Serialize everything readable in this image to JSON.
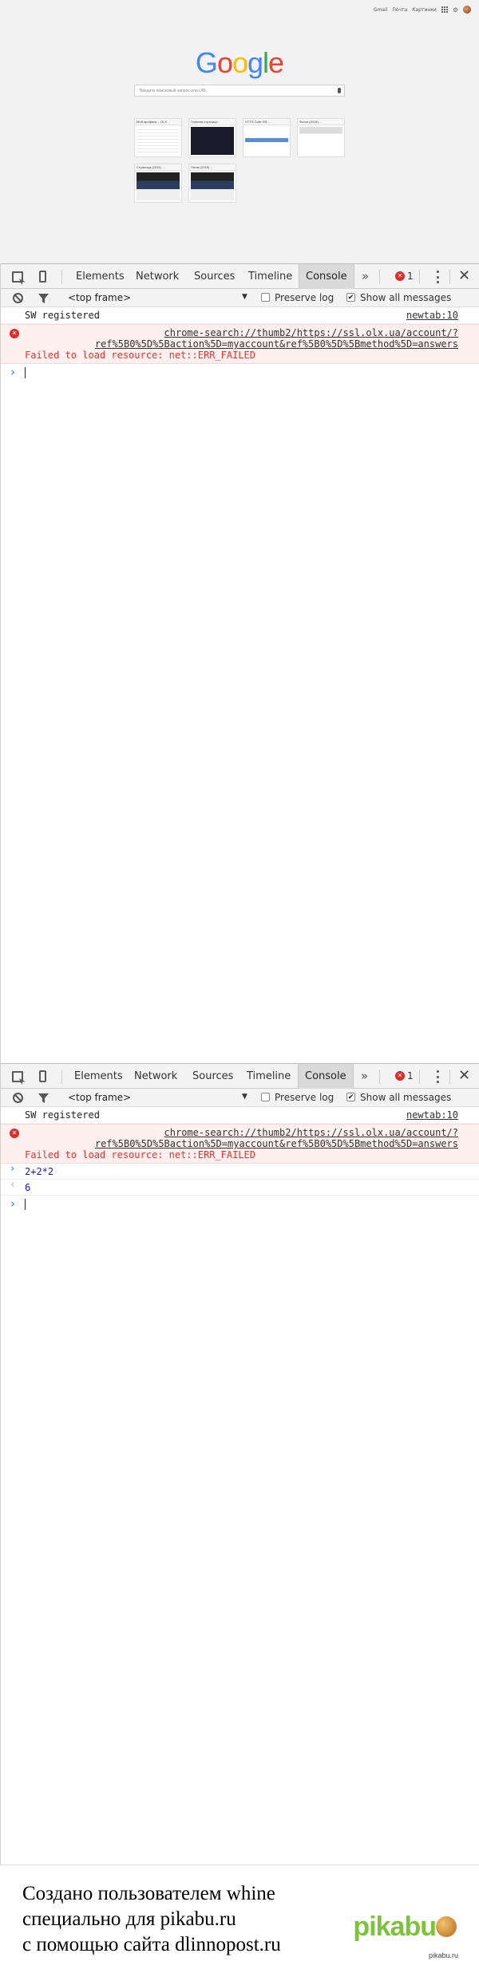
{
  "newtab": {
    "top_links": [
      "Gmail",
      "Почта",
      "Картинки"
    ],
    "search_placeholder": "Введите поисковый запрос или URL",
    "tiles": [
      {
        "title": "Мой профиль – OLX"
      },
      {
        "title": "Главная страница"
      },
      {
        "title": "HTTS Сайт ЛФ…"
      },
      {
        "title": "Фотки (2015) …"
      },
      {
        "title": "Страница (2015) …"
      },
      {
        "title": "Пятак (2015) …"
      }
    ]
  },
  "devtools_top": {
    "tabs": [
      "Elements",
      "Network",
      "Sources",
      "Timeline",
      "Console"
    ],
    "more_label": "»",
    "error_count": "1",
    "filter": {
      "frame": "<top frame>",
      "preserve_log": "Preserve log",
      "preserve_log_checked": false,
      "show_all": "Show all messages",
      "show_all_checked": true
    },
    "messages": [
      {
        "type": "log",
        "text": "SW registered",
        "source": "newtab:10"
      },
      {
        "type": "error",
        "url_line1": "chrome-search://thumb2/https://ssl.olx.ua/account/?",
        "url_line2": "ref%5B0%5D%5Baction%5D=myaccount&ref%5B0%5D%5Bmethod%5D=answers",
        "text": "Failed to load resource: net::ERR_FAILED"
      }
    ]
  },
  "devtools_bottom": {
    "tabs": [
      "Elements",
      "Network",
      "Sources",
      "Timeline",
      "Console"
    ],
    "more_label": "»",
    "error_count": "1",
    "filter": {
      "frame": "<top frame>",
      "preserve_log": "Preserve log",
      "preserve_log_checked": false,
      "show_all": "Show all messages",
      "show_all_checked": true
    },
    "messages": [
      {
        "type": "log",
        "text": "SW registered",
        "source": "newtab:10"
      },
      {
        "type": "error",
        "url_line1": "chrome-search://thumb2/https://ssl.olx.ua/account/?",
        "url_line2": "ref%5B0%5D%5Baction%5D=myaccount&ref%5B0%5D%5Bmethod%5D=answers",
        "text": "Failed to load resource: net::ERR_FAILED"
      }
    ],
    "input": "2+2*2",
    "result": "6"
  },
  "footer": {
    "line1": "Создано пользователем whine",
    "line2": "специально для pikabu.ru",
    "line3": "с помощью сайта dlinnopost.ru",
    "logo_text": "pikabu",
    "logo_small": "pikabu.ru"
  }
}
